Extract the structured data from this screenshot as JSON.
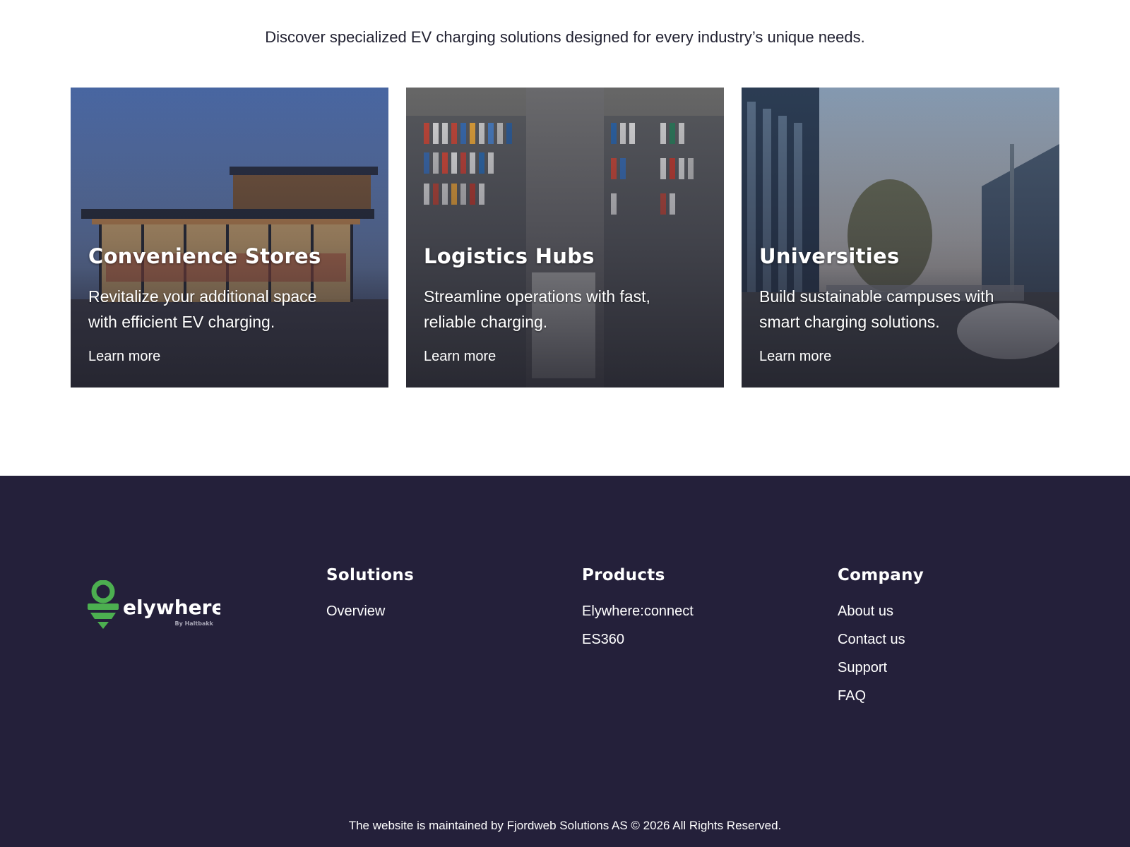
{
  "intro": "Discover specialized EV charging solutions designed for every industry’s unique needs.",
  "cards": [
    {
      "title": "Convenience Stores",
      "description": "Revitalize your additional space with efficient EV charging.",
      "link": "Learn more"
    },
    {
      "title": "Logistics Hubs",
      "description": "Streamline operations with fast, reliable charging.",
      "link": "Learn more"
    },
    {
      "title": "Universities",
      "description": "Build sustainable campuses with smart charging solutions.",
      "link": "Learn more"
    }
  ],
  "footer": {
    "logo": {
      "name": "elywhere",
      "tagline": "By Haltbakk",
      "icon": "location-pin-icon",
      "accent_color": "#4caf50"
    },
    "columns": [
      {
        "heading": "Solutions",
        "links": [
          "Overview"
        ]
      },
      {
        "heading": "Products",
        "links": [
          "Elywhere:connect",
          "ES360"
        ]
      },
      {
        "heading": "Company",
        "links": [
          "About us",
          "Contact us",
          "Support",
          "FAQ"
        ]
      }
    ],
    "copyright": "The website is maintained by Fjordweb Solutions AS © 2026 All Rights Reserved.",
    "background_color": "#24203a"
  }
}
